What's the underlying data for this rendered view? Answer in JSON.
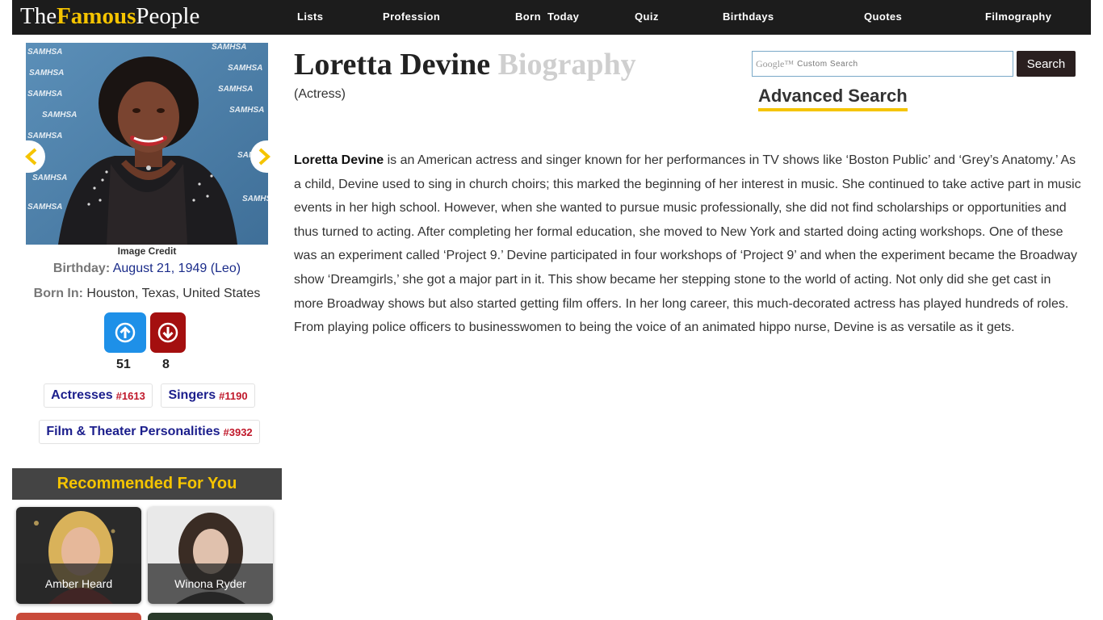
{
  "logo": {
    "part1": "The",
    "part2": "Famous",
    "part3": "People"
  },
  "nav": {
    "lists": "Lists",
    "profession": "Profession",
    "born_today": "Born  Today",
    "quiz": "Quiz",
    "birthdays": "Birthdays",
    "quotes": "Quotes",
    "filmography": "Filmography"
  },
  "photo": {
    "backdrop_text": "SAMHSA",
    "credit": "Image Credit"
  },
  "profile": {
    "birthday_label": "Birthday:",
    "birthday_value": "August 21, 1949 (Leo)",
    "born_in_label": "Born In:",
    "born_in_value": "Houston, Texas, United States"
  },
  "votes": {
    "up": "51",
    "down": "8"
  },
  "tags": [
    {
      "label": "Actresses",
      "rank": "#1613"
    },
    {
      "label": "Singers",
      "rank": "#1190"
    },
    {
      "label": "Film & Theater Personalities",
      "rank": "#3932"
    }
  ],
  "recommended": {
    "heading": "Recommended For You",
    "items": [
      {
        "name": "Amber Heard"
      },
      {
        "name": "Winona Ryder"
      }
    ]
  },
  "main": {
    "name": "Loretta Devine",
    "title_suffix": "Biography",
    "subtitle": "(Actress)",
    "bio_lead": "Loretta Devine",
    "bio_text": " is an American actress and singer known for her performances in TV shows like ‘Boston Public’ and ‘Grey’s Anatomy.’ As a child, Devine used to sing in church choirs; this marked the beginning of her interest in music. She continued to take active part in music events in her high school. However, when she wanted to pursue music professionally, she did not find scholarships or opportunities and thus turned to acting. After completing her formal education, she moved to New York and started doing acting workshops. One of these was an experiment called ‘Project 9.’ Devine participated in four workshops of ‘Project 9’ and when the experiment became the Broadway show ‘Dreamgirls,’ she got a major part in it. This show became her stepping stone to the world of acting. Not only did she get cast in more Broadway shows but also started getting film offers. In her long career, this much-decorated actress has played hundreds of roles. From playing police officers to businesswomen to being the voice of an animated hippo nurse, Devine is as versatile as it gets."
  },
  "search": {
    "brand": "Google™",
    "placeholder": "Custom Search",
    "button": "Search",
    "advanced": "Advanced Search"
  },
  "colors": {
    "accent": "#f5c400",
    "nav_bg": "#1c1c1c",
    "link": "#1b2c8a",
    "rank": "#c0182a",
    "vote_up": "#1e90e8",
    "vote_down": "#a40f0f"
  },
  "icons": [
    "chevron-left-icon",
    "chevron-right-icon",
    "thumbs-up-arrow-icon",
    "thumbs-down-arrow-icon"
  ]
}
